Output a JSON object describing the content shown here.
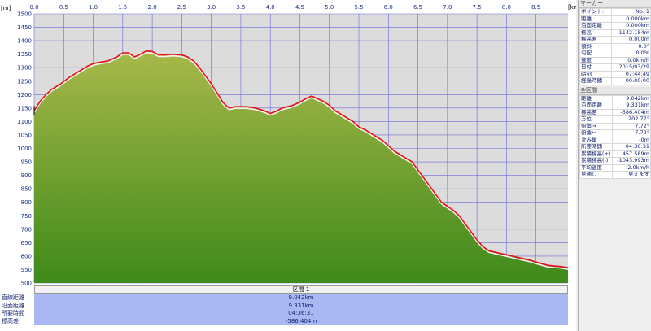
{
  "chart_data": {
    "type": "area",
    "x_unit": "[km]",
    "y_unit": "[m]",
    "xlim": [
      0,
      9.042
    ],
    "ylim": [
      500,
      1500
    ],
    "x_ticks": [
      "0.0",
      "0.5",
      "1.0",
      "1.5",
      "2.0",
      "2.5",
      "3.0",
      "3.5",
      "4.0",
      "4.5",
      "5.0",
      "5.5",
      "6.0",
      "6.5",
      "7.0",
      "7.5",
      "8.0",
      "8.5"
    ],
    "y_ticks": [
      "1500",
      "1450",
      "1400",
      "1350",
      "1300",
      "1250",
      "1200",
      "1150",
      "1100",
      "1050",
      "1000",
      "950",
      "900",
      "850",
      "800",
      "750",
      "700",
      "650",
      "600",
      "550",
      "500"
    ],
    "series": [
      {
        "x": [
          0.0,
          0.1,
          0.2,
          0.3,
          0.45,
          0.6,
          0.75,
          0.9,
          1.0,
          1.1,
          1.25,
          1.4,
          1.5,
          1.6,
          1.7,
          1.8,
          1.9,
          2.0,
          2.1,
          2.2,
          2.35,
          2.5,
          2.6,
          2.7,
          2.8,
          2.9,
          3.0,
          3.1,
          3.2,
          3.3,
          3.4,
          3.5,
          3.6,
          3.75,
          3.9,
          4.0,
          4.1,
          4.2,
          4.35,
          4.5,
          4.6,
          4.7,
          4.8,
          4.9,
          5.0,
          5.1,
          5.25,
          5.4,
          5.5,
          5.6,
          5.75,
          5.9,
          6.0,
          6.1,
          6.25,
          6.4,
          6.5,
          6.6,
          6.7,
          6.8,
          6.9,
          7.0,
          7.1,
          7.2,
          7.3,
          7.4,
          7.5,
          7.6,
          7.7,
          7.8,
          7.9,
          8.0,
          8.1,
          8.2,
          8.3,
          8.4,
          8.5,
          8.6,
          8.7,
          8.8,
          8.9,
          9.042
        ],
        "y": [
          1140,
          1175,
          1200,
          1220,
          1240,
          1265,
          1285,
          1305,
          1315,
          1320,
          1325,
          1340,
          1355,
          1355,
          1340,
          1350,
          1362,
          1360,
          1348,
          1347,
          1350,
          1347,
          1340,
          1325,
          1300,
          1270,
          1240,
          1205,
          1170,
          1150,
          1155,
          1155,
          1155,
          1150,
          1140,
          1130,
          1138,
          1150,
          1158,
          1172,
          1185,
          1195,
          1185,
          1175,
          1160,
          1140,
          1120,
          1100,
          1080,
          1070,
          1050,
          1030,
          1010,
          990,
          970,
          950,
          920,
          890,
          860,
          830,
          800,
          785,
          770,
          750,
          720,
          690,
          660,
          635,
          620,
          615,
          610,
          605,
          600,
          595,
          590,
          585,
          578,
          572,
          566,
          563,
          562,
          557
        ]
      }
    ]
  },
  "unit_y": "[m]",
  "unit_x": "[km]",
  "section_label": "区間 1",
  "summary": {
    "labels": [
      "直線距離",
      "沿面距離",
      "所要時間",
      "標高差"
    ],
    "values": [
      "9.042km",
      "9.331km",
      "04:36:31",
      "-586.404m"
    ]
  },
  "marker_header": "マーカー",
  "marker_rows": [
    {
      "k": "ポイント:",
      "v": "No. 1"
    },
    {
      "k": "距離",
      "v": "0.000km"
    },
    {
      "k": "沿面距離",
      "v": "0.000km"
    },
    {
      "k": "標高",
      "v": "1142.184m"
    },
    {
      "k": "標高差",
      "v": "0.000m"
    },
    {
      "k": "傾斜",
      "v": "0.0°"
    },
    {
      "k": "勾配",
      "v": "0.0%"
    },
    {
      "k": "速度",
      "v": "0.0km/h"
    },
    {
      "k": "日付",
      "v": "2015/03/29"
    },
    {
      "k": "時刻",
      "v": "07:44:49"
    },
    {
      "k": "経過時間",
      "v": "00:00:00"
    }
  ],
  "section_header": "全区間",
  "section_rows": [
    {
      "k": "距離",
      "v": "9.042km"
    },
    {
      "k": "沿面距離",
      "v": "9.331km"
    },
    {
      "k": "標高差",
      "v": "-586.404m"
    },
    {
      "k": "方位",
      "v": "202.77°"
    },
    {
      "k": "俯角→",
      "v": "7.72°"
    },
    {
      "k": "俯角←",
      "v": "-7.72°"
    },
    {
      "k": "沈み量",
      "v": "-0m"
    },
    {
      "k": "所要時間",
      "v": "04:36:31"
    },
    {
      "k": "累積標高(+)",
      "v": "457.589m"
    },
    {
      "k": "累積標高(-)",
      "v": "-1043.993m"
    },
    {
      "k": "平均速度",
      "v": "2.0km/h"
    },
    {
      "k": "見通し",
      "v": "見えます"
    }
  ],
  "colors": {
    "plot_bg": "#dcdcdc",
    "grid": "#6a6ad8",
    "fill_top": "#a8b84a",
    "fill_bottom": "#3e8a1a",
    "line": "#e8101a",
    "summary_bg": "#a9b8f2"
  }
}
